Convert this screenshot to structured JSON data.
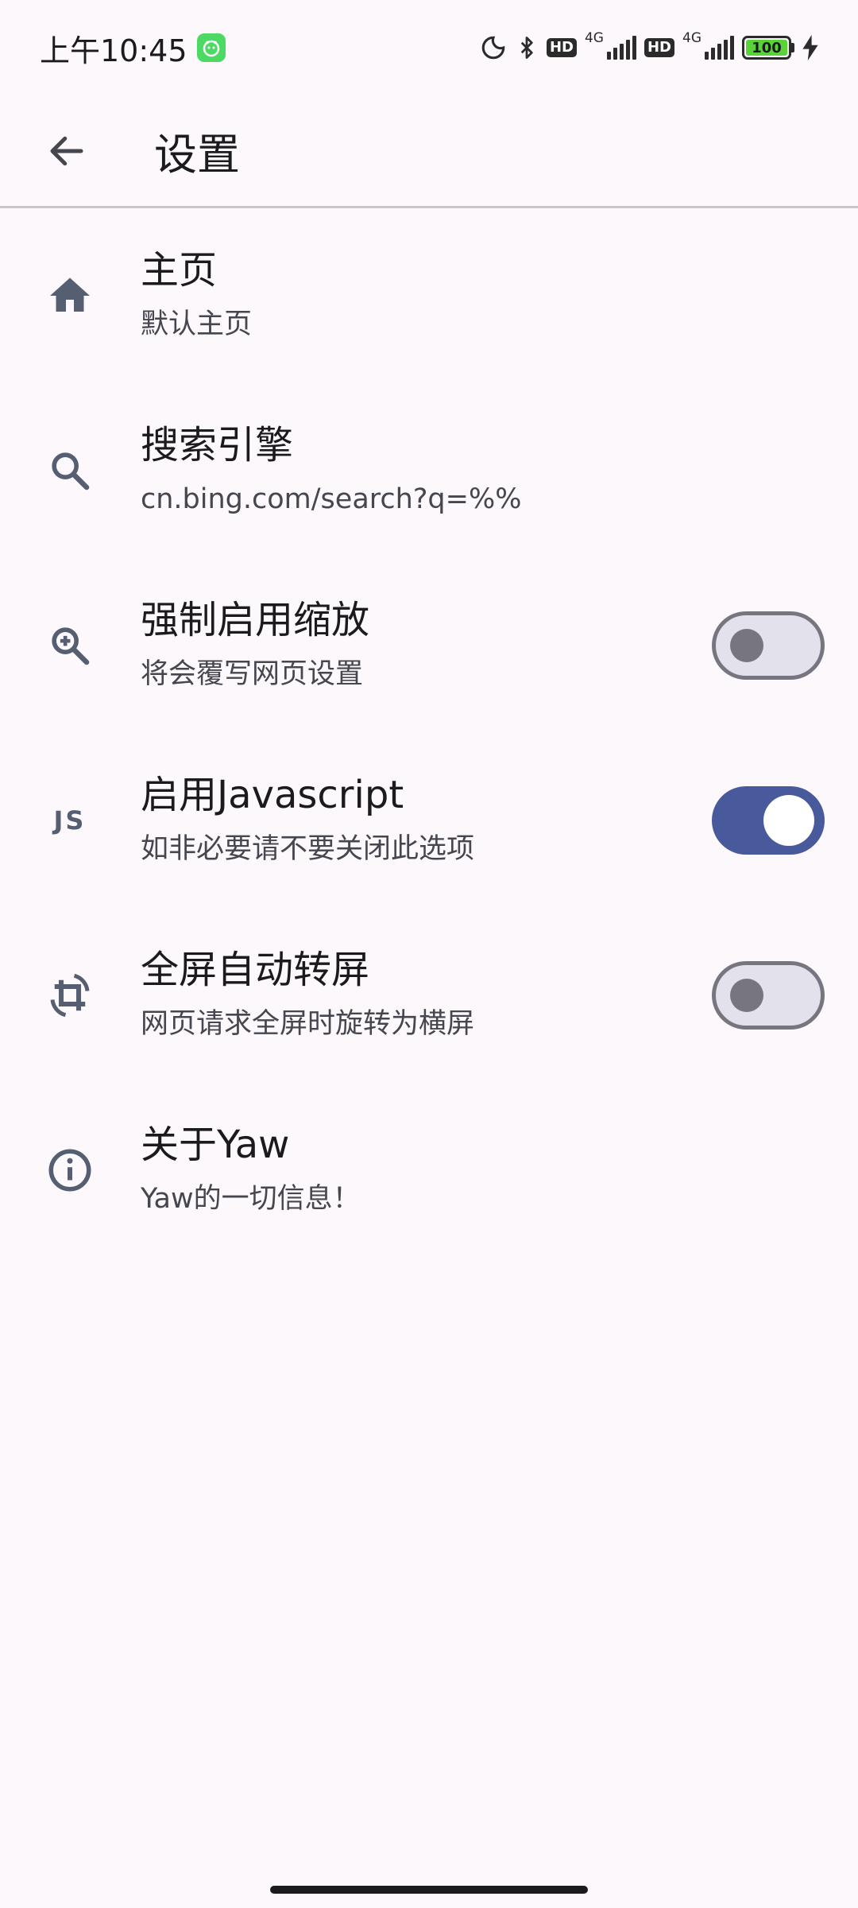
{
  "status_bar": {
    "time": "上午10:45",
    "network_1": "4G",
    "network_2": "4G",
    "hd_1": "HD",
    "hd_2": "HD",
    "battery": "100"
  },
  "app_bar": {
    "title": "设置"
  },
  "settings": [
    {
      "title": "主页",
      "subtitle": "默认主页",
      "icon": "home-icon"
    },
    {
      "title": "搜索引擎",
      "subtitle": "cn.bing.com/search?q=%%",
      "icon": "search-icon"
    },
    {
      "title": "强制启用缩放",
      "subtitle": "将会覆写网页设置",
      "icon": "zoom-in-icon",
      "toggle": false
    },
    {
      "title": "启用Javascript",
      "subtitle": "如非必要请不要关闭此选项",
      "icon": "javascript-icon",
      "icon_text": "JS",
      "toggle": true
    },
    {
      "title": "全屏自动转屏",
      "subtitle": "网页请求全屏时旋转为横屏",
      "icon": "screen-rotation-icon",
      "toggle": false
    },
    {
      "title": "关于Yaw",
      "subtitle": "Yaw的一切信息！",
      "icon": "info-icon"
    }
  ],
  "colors": {
    "background": "#fcf8fc",
    "accent": "#485a9b",
    "icon": "#565e71",
    "divider": "#c8c6cc"
  }
}
